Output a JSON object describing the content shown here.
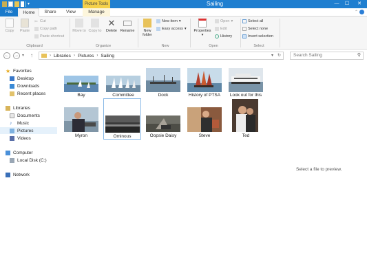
{
  "window": {
    "title": "Sailing",
    "contextual_tab": "Picture Tools",
    "controls": {
      "minimize": "—",
      "maximize": "☐",
      "close": "✕"
    }
  },
  "tabs": {
    "file": "File",
    "home": "Home",
    "share": "Share",
    "view": "View",
    "manage": "Manage"
  },
  "ribbon": {
    "clipboard": {
      "label": "Clipboard",
      "copy": "Copy",
      "paste": "Paste",
      "cut": "Cut",
      "copy_path": "Copy path",
      "paste_shortcut": "Paste shortcut"
    },
    "organize": {
      "label": "Organize",
      "move_to": "Move to",
      "copy_to": "Copy to",
      "delete": "Delete",
      "rename": "Rename"
    },
    "new": {
      "label": "New",
      "new_folder": "New folder",
      "new_item": "New item",
      "easy_access": "Easy access"
    },
    "open": {
      "label": "Open",
      "properties": "Properties",
      "open": "Open",
      "edit": "Edit",
      "history": "History"
    },
    "select": {
      "label": "Select",
      "select_all": "Select all",
      "select_none": "Select none",
      "invert_selection": "Invert selection"
    }
  },
  "address": {
    "crumbs": [
      "Libraries",
      "Pictures",
      "Sailing"
    ],
    "search_placeholder": "Search Sailing"
  },
  "nav_pane": {
    "favorites": "Favorites",
    "desktop": "Desktop",
    "downloads": "Downloads",
    "recent_places": "Recent places",
    "libraries": "Libraries",
    "documents": "Documents",
    "music": "Music",
    "pictures": "Pictures",
    "videos": "Videos",
    "computer": "Computer",
    "local_disk": "Local Disk (C:)",
    "network": "Network"
  },
  "files": [
    {
      "name": "Bay"
    },
    {
      "name": "Committee"
    },
    {
      "name": "Dock"
    },
    {
      "name": "History of PTSA"
    },
    {
      "name": "Look out for this"
    },
    {
      "name": "Myron"
    },
    {
      "name": "Ominous"
    },
    {
      "name": "Oopsie Daisy"
    },
    {
      "name": "Steve"
    },
    {
      "name": "Ted"
    }
  ],
  "preview_text": "Select a file to preview."
}
